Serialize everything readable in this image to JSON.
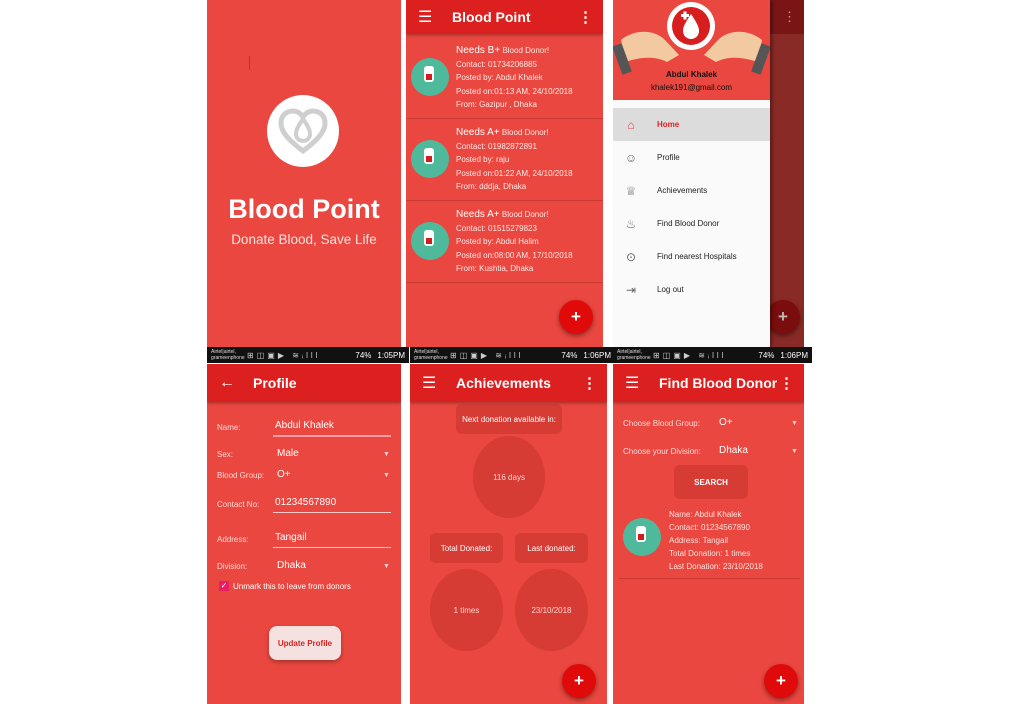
{
  "splash": {
    "title": "Blood Point",
    "tagline": "Donate Blood, Save Life"
  },
  "feed": {
    "title": "Blood Point",
    "posts": [
      {
        "needs": "Needs B+",
        "suffix": "Blood Donor!",
        "contact": "Contact: 01734206885",
        "posted_by": "Posted by: Abdul Khalek",
        "posted_on": "Posted on:01:13 AM, 24/10/2018",
        "from": "From: Gazipur , Dhaka"
      },
      {
        "needs": "Needs A+",
        "suffix": "Blood Donor!",
        "contact": "Contact: 01982872891",
        "posted_by": "Posted by: raju",
        "posted_on": "Posted on:01:22 AM, 24/10/2018",
        "from": "From: dddja, Dhaka"
      },
      {
        "needs": "Needs A+",
        "suffix": "Blood Donor!",
        "contact": "Contact: 01515279823",
        "posted_by": "Posted by: Abdul Halim",
        "posted_on": "Posted on:08:00 AM, 17/10/2018",
        "from": "From: Kushtia, Dhaka"
      }
    ],
    "fab": "+"
  },
  "drawer": {
    "user_name": "Abdul Khalek",
    "email": "khalek191@gmail.com",
    "items": [
      {
        "label": "Home",
        "icon": "home-icon"
      },
      {
        "label": "Profile",
        "icon": "profile-icon"
      },
      {
        "label": "Achievements",
        "icon": "trophy-icon"
      },
      {
        "label": "Find Blood Donor",
        "icon": "donor-icon"
      },
      {
        "label": "Find nearest Hospitals",
        "icon": "location-pin-icon"
      },
      {
        "label": "Log out",
        "icon": "logout-icon"
      }
    ],
    "fab": "+"
  },
  "status_bar": {
    "carrier": "Airtel|airtel, grameenphone",
    "battery": "74%",
    "times": [
      "1:05PM",
      "1:06PM"
    ]
  },
  "profile": {
    "title": "Profile",
    "name_label": "Name:",
    "name_value": "Abdul Khalek",
    "sex_label": "Sex:",
    "sex_value": "Male",
    "group_label": "Blood Group:",
    "group_value": "O+",
    "contact_label": "Contact No:",
    "contact_value": "01234567890",
    "address_label": "Address:",
    "address_value": "Tangail",
    "division_label": "Division:",
    "division_value": "Dhaka",
    "checkbox_label": "Unmark this to leave from donors",
    "update_button": "Update Profile"
  },
  "achievements": {
    "title": "Achievements",
    "next_label": "Next donation available in:",
    "next_value": "116 days",
    "total_label": "Total Donated:",
    "total_value": "1 times",
    "last_label": "Last donated:",
    "last_value": "23/10/2018",
    "fab": "+"
  },
  "find_donor": {
    "title": "Find Blood Donor",
    "group_label": "Choose Blood Group:",
    "group_value": "O+",
    "division_label": "Choose your Division:",
    "division_value": "Dhaka",
    "search_button": "SEARCH",
    "result": {
      "name": "Name: Abdul Khalek",
      "contact": "Contact: 01234567890",
      "address": "Address: Tangail",
      "total": "Total Donation: 1 times",
      "last": "Last Donation: 23/10/2018"
    },
    "fab": "+"
  },
  "colors": {
    "primary": "#dc1f1f",
    "background": "#e9473f",
    "accent_teal": "#4fb99c",
    "checkbox": "#e91e63"
  }
}
